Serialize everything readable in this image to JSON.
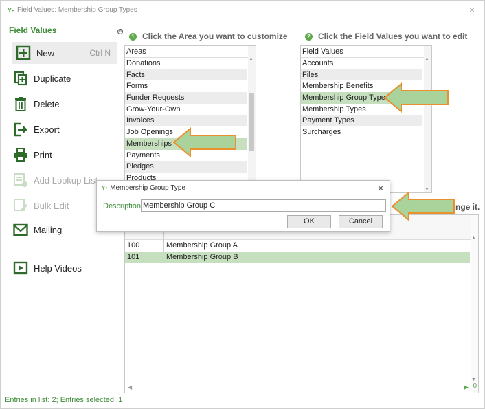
{
  "window": {
    "title": "Field Values: Membership Group Types",
    "close": "×"
  },
  "sidebar": {
    "heading": "Field Values",
    "items": [
      {
        "label": "New",
        "shortcut": "Ctrl N",
        "icon": "plus-square-icon"
      },
      {
        "label": "Duplicate",
        "icon": "duplicate-icon"
      },
      {
        "label": "Delete",
        "icon": "trash-icon"
      },
      {
        "label": "Export",
        "icon": "export-icon"
      },
      {
        "label": "Print",
        "icon": "printer-icon"
      },
      {
        "label": "Add Lookup List",
        "icon": "add-lookup-icon"
      },
      {
        "label": "Bulk Edit",
        "icon": "bulk-edit-icon"
      },
      {
        "label": "Mailing",
        "icon": "mail-icon"
      },
      {
        "label": "Help Videos",
        "icon": "video-icon"
      }
    ]
  },
  "collapse": "⊖",
  "steps": {
    "s1": {
      "num": "1",
      "label": "Click the Area you want to customize"
    },
    "s2": {
      "num": "2",
      "label": "Click the Field Values you want to edit"
    }
  },
  "areas": {
    "header": "Areas",
    "rows": [
      "Donations",
      "Facts",
      "Forms",
      "Funder Requests",
      "Grow-Your-Own",
      "Invoices",
      "Job Openings",
      "Memberships",
      "Payments",
      "Pledges",
      "Products"
    ]
  },
  "field_values": {
    "header": "Field Values",
    "rows": [
      "Accounts",
      "Files",
      "Membership Benefits",
      "Membership Group Types",
      "Membership Types",
      "Payment Types",
      "Surcharges"
    ]
  },
  "truncated_hint": "nge it.",
  "table": {
    "rows": [
      {
        "code": "100",
        "name": "Membership Group A"
      },
      {
        "code": "101",
        "name": "Membership Group B"
      }
    ],
    "corner": "0"
  },
  "status": "Entries in list: 2; Entries selected: 1",
  "dialog": {
    "title": "Membership Group Type",
    "close": "×",
    "label": "Description",
    "value": "Membership Group C",
    "ok": "OK",
    "cancel": "Cancel"
  },
  "colors": {
    "accent": "#3f8e3a",
    "selection": "#c6e0bf",
    "arrow_fill": "#a9d39a",
    "arrow_stroke": "#e8912e"
  }
}
